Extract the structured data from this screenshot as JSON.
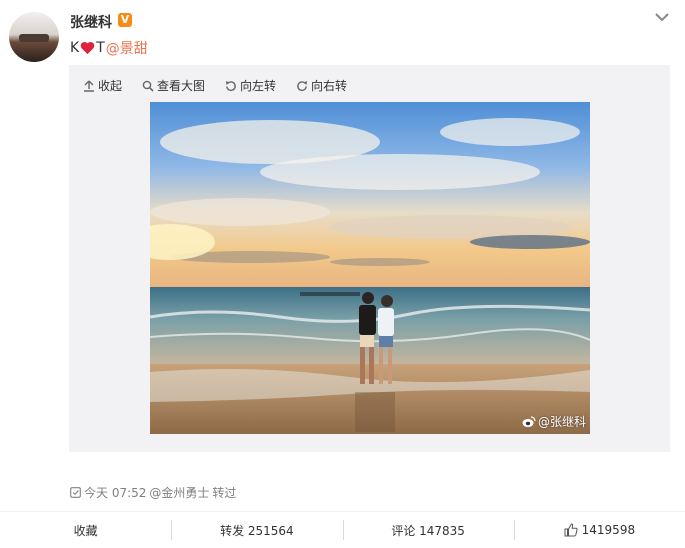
{
  "post": {
    "username": "张继科",
    "verified_badge": "V",
    "text_before": "K",
    "text_after": "T",
    "mention": "@景甜"
  },
  "toolbar": {
    "collapse": "收起",
    "view_large": "查看大图",
    "rotate_left": "向左转",
    "rotate_right": "向右转"
  },
  "photo": {
    "watermark": "@张继科"
  },
  "meta": {
    "time": "今天 07:52",
    "via_user": "@金州勇士",
    "via_action": "转过"
  },
  "actions": {
    "favorite": "收藏",
    "repost": "转发 251564",
    "comment": "评论 147835",
    "like": "1419598"
  },
  "colors": {
    "mention": "#eb7350",
    "badge": "#f78b14",
    "heart": "#e0233c"
  },
  "icons": [
    "chevron-down-icon",
    "heart-icon",
    "upload-icon",
    "search-icon",
    "rotate-left-icon",
    "rotate-right-icon",
    "weibo-icon",
    "clock-icon",
    "thumbs-up-icon"
  ]
}
